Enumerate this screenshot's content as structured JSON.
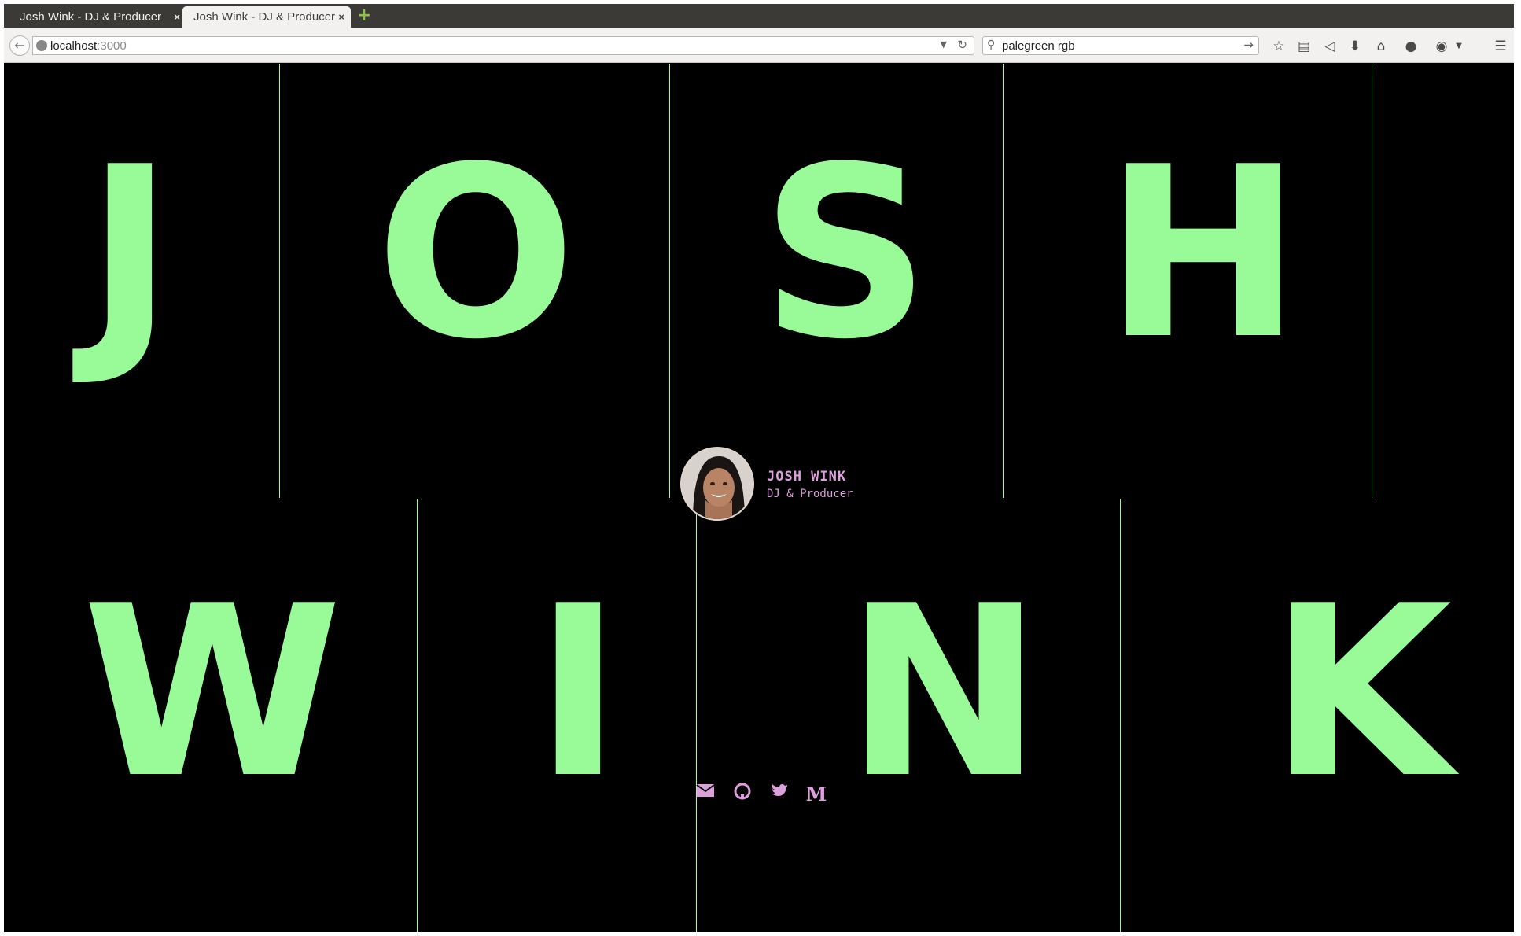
{
  "browser": {
    "tabs": [
      {
        "title": "Josh Wink - DJ & Producer",
        "active": false
      },
      {
        "title": "Josh Wink - DJ & Producer",
        "active": true
      }
    ],
    "tab_close_glyph": "×",
    "new_tab_glyph": "+",
    "url_host": "localhost",
    "url_port": ":3000",
    "search_query": "palegreen rgb",
    "toolbar_icons": [
      "bookmark-star-icon",
      "reading-list-icon",
      "pocket-icon",
      "download-icon",
      "home-icon",
      "chat-icon",
      "adblock-icon",
      "menu-icon"
    ]
  },
  "page": {
    "background": "#000000",
    "accent": "#98fb98",
    "secondary_accent": "#dda0dd",
    "title_letters_row1": [
      "J",
      "O",
      "S",
      "H"
    ],
    "title_letters_row2": [
      "W",
      "I",
      "N",
      "K"
    ],
    "profile": {
      "name": "JOSH WINK",
      "role": "DJ & Producer"
    },
    "social_links": [
      "email-icon",
      "github-icon",
      "twitter-icon",
      "medium-icon"
    ]
  }
}
